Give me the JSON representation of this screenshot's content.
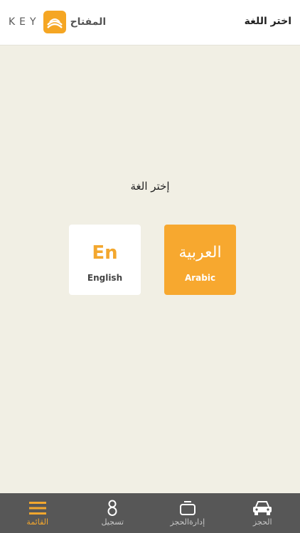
{
  "header": {
    "title": "اختر اللغة",
    "logo_latin": "KEY",
    "logo_arabic": "المفتاح"
  },
  "main": {
    "prompt": "إختر الغة",
    "languages": [
      {
        "big": "En",
        "label": "English",
        "selected": false
      },
      {
        "big": "العربية",
        "label": "Arabic",
        "selected": true
      }
    ]
  },
  "tabbar": {
    "items": [
      {
        "label": "القائمة",
        "icon": "menu-icon",
        "active": true
      },
      {
        "label": "تسجيل",
        "icon": "user-icon",
        "active": false
      },
      {
        "label": "إدارةالحجز",
        "icon": "manage-booking-icon",
        "active": false
      },
      {
        "label": "الحجز",
        "icon": "car-icon",
        "active": false
      }
    ]
  },
  "colors": {
    "accent": "#f3a72e",
    "background": "#f1efe4",
    "tabbar": "#575757"
  }
}
